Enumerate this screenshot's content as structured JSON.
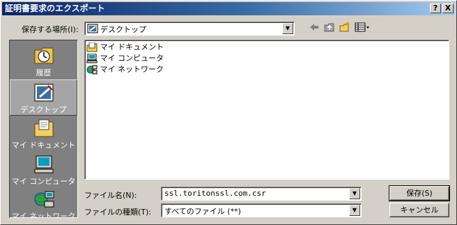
{
  "window": {
    "title": "証明書要求のエクスポート",
    "help_label": "?",
    "close_label": "X"
  },
  "toolbar": {
    "location_label": "保存する場所(I):",
    "location_value": "デスクトップ"
  },
  "places": [
    {
      "label": "履歴"
    },
    {
      "label": "デスクトップ"
    },
    {
      "label": "マイ ドキュメント"
    },
    {
      "label": "マイ コンピュータ"
    },
    {
      "label": "マイ ネットワーク"
    }
  ],
  "files": [
    {
      "name": "マイ ドキュメント",
      "icon": "documents-icon"
    },
    {
      "name": "マイ コンピュータ",
      "icon": "computer-icon"
    },
    {
      "name": "マイ ネットワーク",
      "icon": "network-icon"
    }
  ],
  "form": {
    "filename_label": "ファイル名(N):",
    "filename_value": "ssl.toritonssl.com.csr",
    "filetype_label": "ファイルの種類(T):",
    "filetype_value": "すべてのファイル (**)"
  },
  "buttons": {
    "save": "保存(S)",
    "cancel": "キャンセル"
  }
}
